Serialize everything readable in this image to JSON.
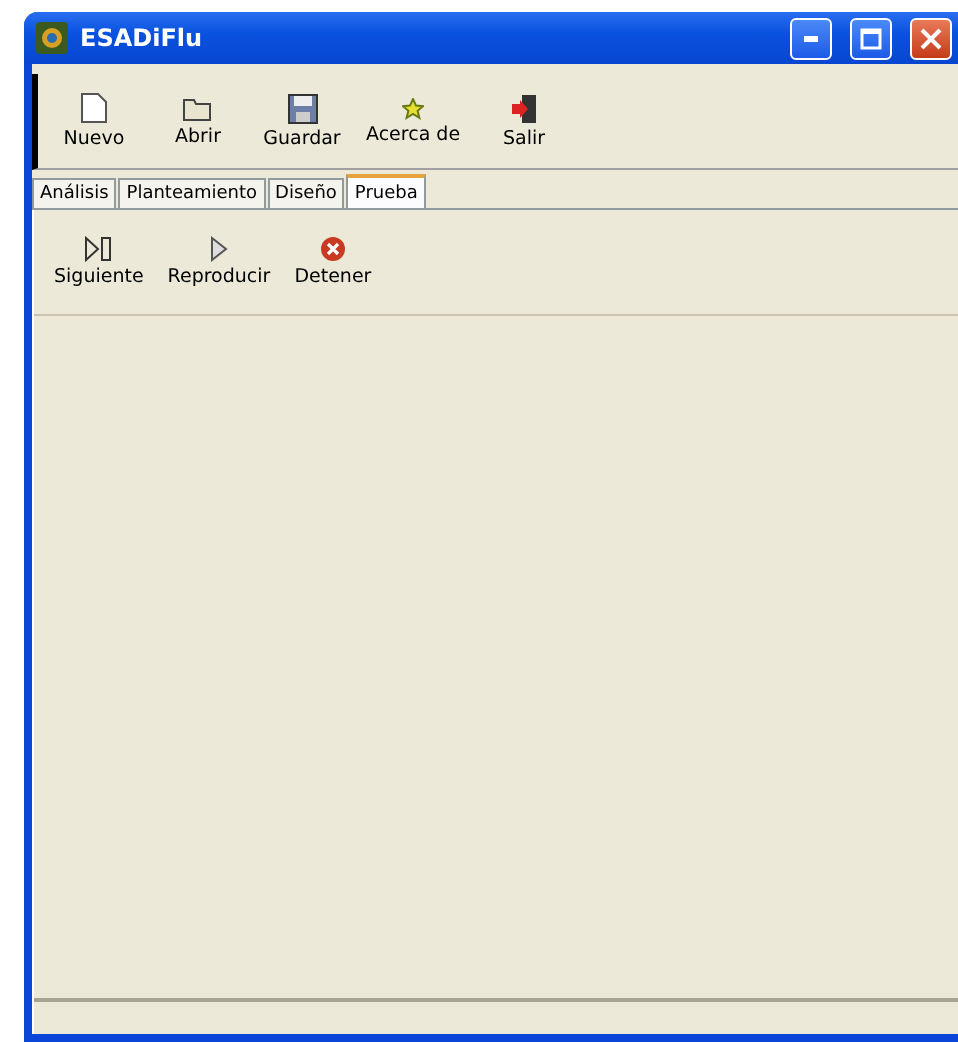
{
  "window": {
    "title": "ESADiFlu"
  },
  "toolbar": [
    {
      "label": "Nuevo",
      "kind": "new"
    },
    {
      "label": "Abrir",
      "kind": "open"
    },
    {
      "label": "Guardar",
      "kind": "save"
    },
    {
      "label": "Acerca de",
      "kind": "about"
    },
    {
      "label": "Salir",
      "kind": "exit"
    }
  ],
  "tabs": [
    {
      "label": "Análisis",
      "selected": false
    },
    {
      "label": "Planteamiento",
      "selected": false
    },
    {
      "label": "Diseño",
      "selected": false
    },
    {
      "label": "Prueba",
      "selected": true
    }
  ],
  "test_toolbar": [
    {
      "label": "Siguiente",
      "kind": "step"
    },
    {
      "label": "Reproducir",
      "kind": "play"
    },
    {
      "label": "Detener",
      "kind": "stop"
    }
  ]
}
